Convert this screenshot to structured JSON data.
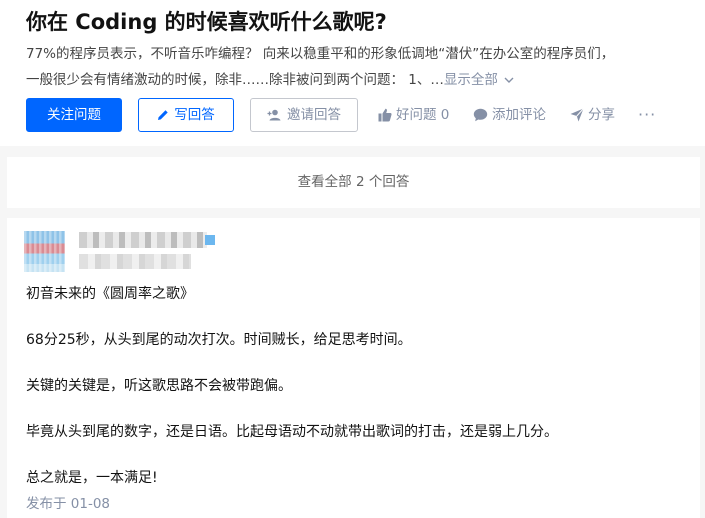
{
  "question": {
    "title": "你在 Coding 的时候喜欢听什么歌呢?",
    "description_lines": [
      "77%的程序员表示，不听音乐咋编程？ 向来以稳重平和的形象低调地“潜伏”在办公室的程序员们，",
      "一般很少会有情绪激动的时候，除非……除非被问到两个问题： 1、…"
    ],
    "show_all_label": "显示全部",
    "show_all_icon": "chevron-down-icon"
  },
  "actions": {
    "follow_label": "关注问题",
    "write_label": "写回答",
    "invite_label": "邀请回答",
    "good_question_label": "好问题 0",
    "comment_label": "添加评论",
    "share_label": "分享",
    "more_label": "···"
  },
  "view_all": {
    "label": "查看全部 2 个回答"
  },
  "answer": {
    "paragraphs": [
      "初音未来的《圆周率之歌》",
      "68分25秒，从头到尾的动次打次。时间贼长，给足思考时间。",
      "关键的关键是，听这歌思路不会被带跑偏。",
      "毕竟从头到尾的数字，还是日语。比起母语动不动就带出歌词的打击，还是弱上几分。",
      "总之就是，一本满足!"
    ],
    "published": "发布于 01-08"
  },
  "colors": {
    "accent": "#0066ff",
    "meta": "#8590a6",
    "background": "#f6f6f6"
  }
}
